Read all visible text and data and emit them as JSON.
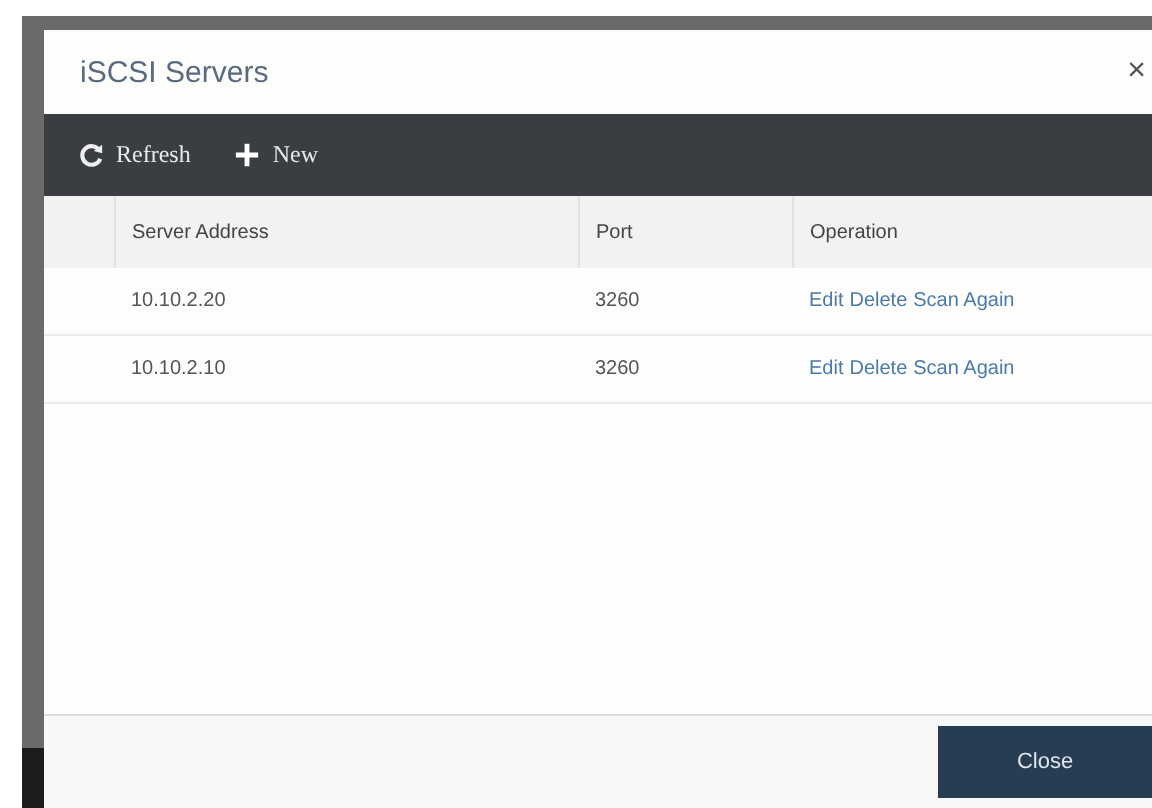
{
  "dialog": {
    "title": "iSCSI Servers",
    "close_symbol": "×"
  },
  "toolbar": [
    {
      "kind": "refresh",
      "label": "Refresh"
    },
    {
      "kind": "add",
      "label": "New"
    }
  ],
  "table": {
    "columns": [
      "Server Address",
      "Port",
      "Operation"
    ],
    "rows": [
      {
        "server_address": "10.10.2.20",
        "port": "3260",
        "operations": [
          "Edit",
          "Delete",
          "Scan Again"
        ]
      },
      {
        "server_address": "10.10.2.10",
        "port": "3260",
        "operations": [
          "Edit",
          "Delete",
          "Scan Again"
        ]
      }
    ]
  },
  "footer": {
    "button": "Close"
  }
}
